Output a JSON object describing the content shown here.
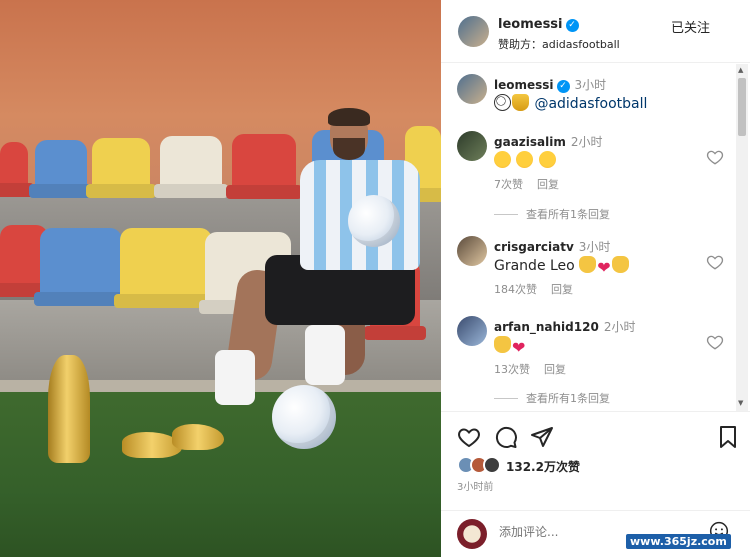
{
  "post": {
    "author": "leomessi",
    "sponsor_label": "赞助方：adidasfootball",
    "follow_label": "已关注"
  },
  "caption": {
    "author": "leomessi",
    "time": "3小时",
    "mention": "@adidasfootball"
  },
  "comments": [
    {
      "user": "gaazisalim",
      "time": "2小时",
      "likes": "7次赞",
      "reply": "回复",
      "view_replies": "查看所有1条回复"
    },
    {
      "user": "crisgarciatv",
      "time": "3小时",
      "text": "Grande Leo",
      "likes": "184次赞",
      "reply": "回复"
    },
    {
      "user": "arfan_nahid120",
      "time": "2小时",
      "likes": "13次赞",
      "reply": "回复",
      "view_replies": "查看所有1条回复"
    }
  ],
  "stats": {
    "likes": "132.2万次赞",
    "posted": "3小时前"
  },
  "composer": {
    "placeholder": "添加评论..."
  },
  "watermark": "www.365jz.com",
  "colors": {
    "verified": "#0095f6",
    "mention": "#00376b",
    "heart": "#e0245e"
  }
}
